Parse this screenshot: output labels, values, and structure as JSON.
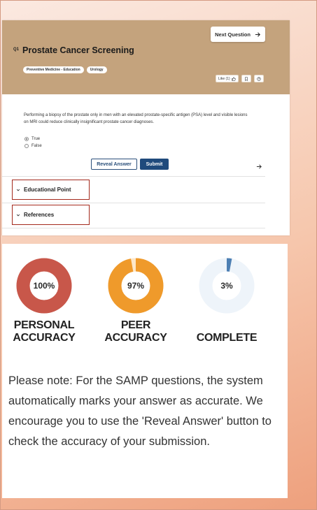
{
  "question": {
    "number": "Q1",
    "title": "Prostate Cancer Screening",
    "next_label": "Next Question",
    "tags": [
      "Preventive Medicine - Education",
      "Urology"
    ],
    "like_label": "Like (1)",
    "stem": "Performing a biopsy of the prostate only in men with an elevated prostate-specific antigen (PSA) level and visible lesions on MRI could reduce clinically insignificant prostate cancer diagnoses.",
    "options": [
      {
        "label": "True",
        "selected": true
      },
      {
        "label": "False",
        "selected": false
      }
    ],
    "reveal_label": "Reveal Answer",
    "submit_label": "Submit",
    "accordion": [
      "Educational Point",
      "References"
    ]
  },
  "stats": [
    {
      "value": "100%",
      "fraction": 1.0,
      "label_line1": "PERSONAL",
      "label_line2": "ACCURACY",
      "color": "#c8574a",
      "track": "#f4d7d2"
    },
    {
      "value": "97%",
      "fraction": 0.97,
      "label_line1": "PEER",
      "label_line2": "ACCURACY",
      "color": "#ef9a2b",
      "track": "#fde7c9"
    },
    {
      "value": "3%",
      "fraction": 0.03,
      "label_line1": "",
      "label_line2": "COMPLETE",
      "color": "#4d7fb3",
      "track": "#eef4fa"
    }
  ],
  "note": "Please note: For the SAMP questions, the system automatically marks your answer as accurate. We encourage you to use the 'Reveal Answer' button to check the accuracy of your submission.",
  "colors": {
    "header_bg": "#c4a37d",
    "primary": "#1f4a7c",
    "accordion_border": "#a4291c"
  }
}
